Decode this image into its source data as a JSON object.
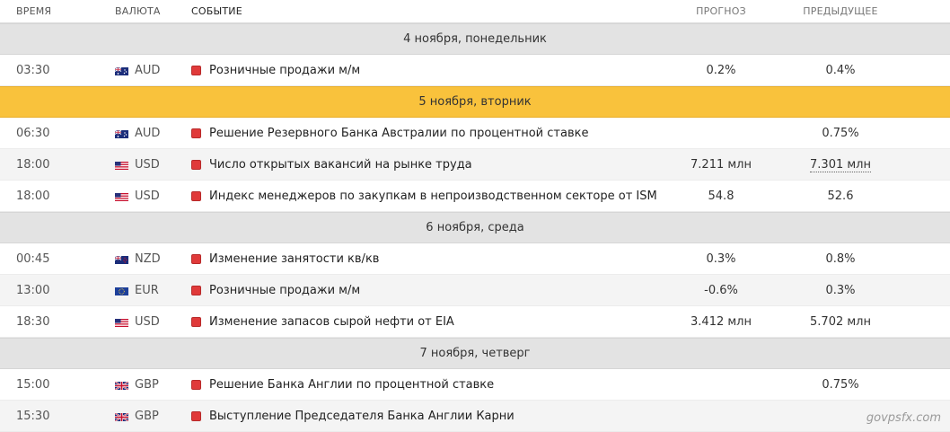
{
  "headers": {
    "time": "ВРЕМЯ",
    "currency": "ВАЛЮТА",
    "event": "СОБЫТИЕ",
    "forecast": "ПРОГНОЗ",
    "previous": "ПРЕДЫДУЩЕЕ"
  },
  "days": [
    {
      "label": "4 ноября, понедельник",
      "highlighted": false,
      "events": [
        {
          "time": "03:30",
          "currency": "AUD",
          "flag": "australia-flag-icon",
          "event": "Розничные продажи м/м",
          "forecast": "0.2%",
          "previous": "0.4%",
          "importance": "high"
        }
      ]
    },
    {
      "label": "5 ноября, вторник",
      "highlighted": true,
      "events": [
        {
          "time": "06:30",
          "currency": "AUD",
          "flag": "australia-flag-icon",
          "event": "Решение Резервного Банка Австралии по процентной ставке",
          "forecast": "",
          "previous": "0.75%",
          "importance": "high"
        },
        {
          "time": "18:00",
          "currency": "USD",
          "flag": "usa-flag-icon",
          "event": "Число открытых вакансий на рынке труда",
          "forecast": "7.211 млн",
          "previous": "7.301 млн",
          "previous_revised": true,
          "importance": "high"
        },
        {
          "time": "18:00",
          "currency": "USD",
          "flag": "usa-flag-icon",
          "event": "Индекс менеджеров по закупкам в непроизводственном секторе от ISM",
          "forecast": "54.8",
          "previous": "52.6",
          "importance": "high"
        }
      ]
    },
    {
      "label": "6 ноября, среда",
      "highlighted": false,
      "events": [
        {
          "time": "00:45",
          "currency": "NZD",
          "flag": "new-zealand-flag-icon",
          "event": "Изменение занятости кв/кв",
          "forecast": "0.3%",
          "previous": "0.8%",
          "importance": "high"
        },
        {
          "time": "13:00",
          "currency": "EUR",
          "flag": "eu-flag-icon",
          "event": "Розничные продажи м/м",
          "forecast": "-0.6%",
          "previous": "0.3%",
          "importance": "high"
        },
        {
          "time": "18:30",
          "currency": "USD",
          "flag": "usa-flag-icon",
          "event": "Изменение запасов сырой нефти от EIA",
          "forecast": "3.412 млн",
          "previous": "5.702 млн",
          "importance": "high"
        }
      ]
    },
    {
      "label": "7 ноября, четверг",
      "highlighted": false,
      "events": [
        {
          "time": "15:00",
          "currency": "GBP",
          "flag": "uk-flag-icon",
          "event": "Решение Банка Англии по процентной ставке",
          "forecast": "",
          "previous": "0.75%",
          "importance": "high"
        },
        {
          "time": "15:30",
          "currency": "GBP",
          "flag": "uk-flag-icon",
          "event": "Выступление Председателя Банка Англии Карни",
          "forecast": "",
          "previous": "",
          "importance": "high"
        }
      ]
    }
  ],
  "colors": {
    "highlight_day": "#f9c23c",
    "day_bar": "#e3e3e3",
    "importance_high": "#e03a3a"
  },
  "watermark": "govpsfx.com"
}
